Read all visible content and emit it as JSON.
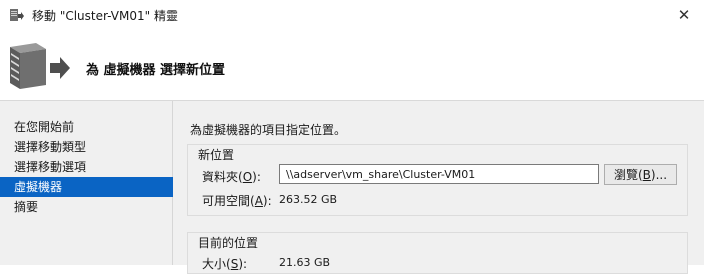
{
  "window": {
    "title": "移動 \"Cluster-VM01\" 精靈",
    "close_glyph": "✕"
  },
  "header": {
    "title": "為 虛擬機器 選擇新位置"
  },
  "sidebar": {
    "items": [
      {
        "label": "在您開始前"
      },
      {
        "label": "選擇移動類型"
      },
      {
        "label": "選擇移動選項"
      },
      {
        "label": "虛擬機器",
        "active": true
      },
      {
        "label": "摘要"
      }
    ]
  },
  "main": {
    "instruction": "為虛擬機器的項目指定位置。",
    "new_location": {
      "legend": "新位置",
      "folder_label": "資料夾",
      "folder_key": "O",
      "folder_value": "\\\\adserver\\vm_share\\Cluster-VM01",
      "browse_label": "瀏覽",
      "browse_key": "B",
      "browse_suffix": "...",
      "free_space_label": "可用空間",
      "free_space_key": "A",
      "free_space_value": "263.52 GB"
    },
    "current_location": {
      "legend": "目前的位置",
      "size_label": "大小",
      "size_key": "S",
      "size_value": "21.63 GB"
    }
  },
  "colors": {
    "accent": "#0a64c4",
    "sidebar_bg": "#f0f0f0"
  },
  "icons": [
    "move-wizard-app-icon",
    "server-move-icon",
    "close-icon"
  ]
}
